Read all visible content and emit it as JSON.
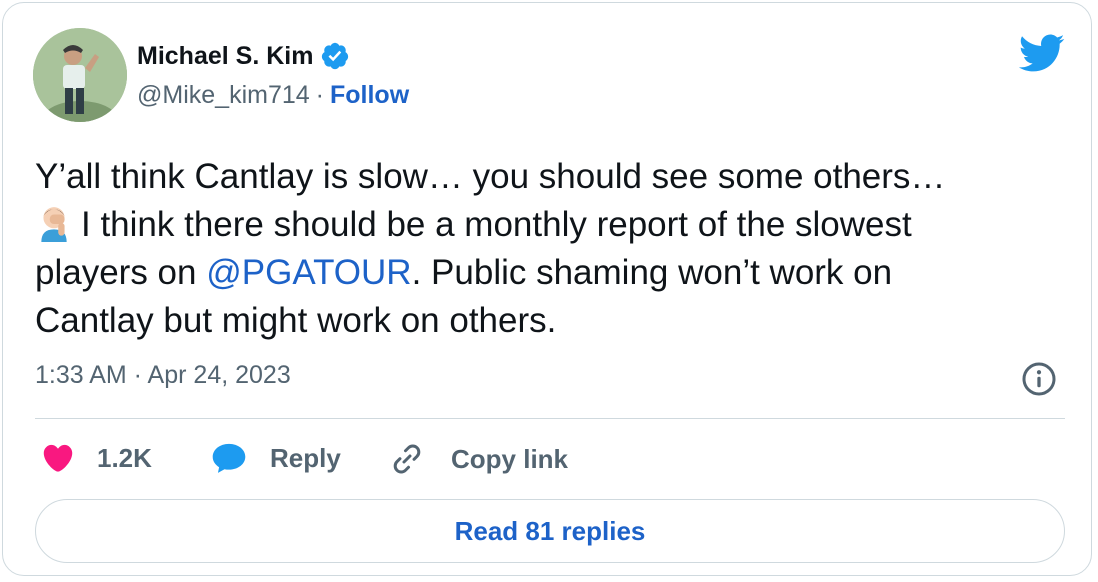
{
  "author": {
    "name": "Michael S. Kim",
    "handle": "@Mike_kim714",
    "separator": "·",
    "follow_label": "Follow",
    "verified": true
  },
  "tweet": {
    "line1": "Y’all think Cantlay is slow… you should see some others…",
    "emoji": "man-facepalming-emoji",
    "line2": "I think there should be a monthly report of the slowest",
    "line3_prefix": "players on ",
    "mention": "@PGATOUR",
    "line3_suffix": ". Public shaming won’t work on",
    "line4": "Cantlay but might work on others."
  },
  "timestamp": "1:33 AM · Apr 24, 2023",
  "actions": {
    "likes": "1.2K",
    "reply_label": "Reply",
    "copy_label": "Copy link"
  },
  "read_replies_label": "Read 81 replies",
  "icons": {
    "brand": "twitter-bird-icon",
    "info": "info-icon",
    "like": "heart-icon",
    "reply": "speech-bubble-icon",
    "copy": "link-icon"
  },
  "colors": {
    "link": "#1d62c8",
    "heart": "#f91880",
    "bird": "#1d9bf0",
    "reply_icon": "#1d9bf0",
    "muted": "#536471",
    "border": "#cfd9de"
  }
}
